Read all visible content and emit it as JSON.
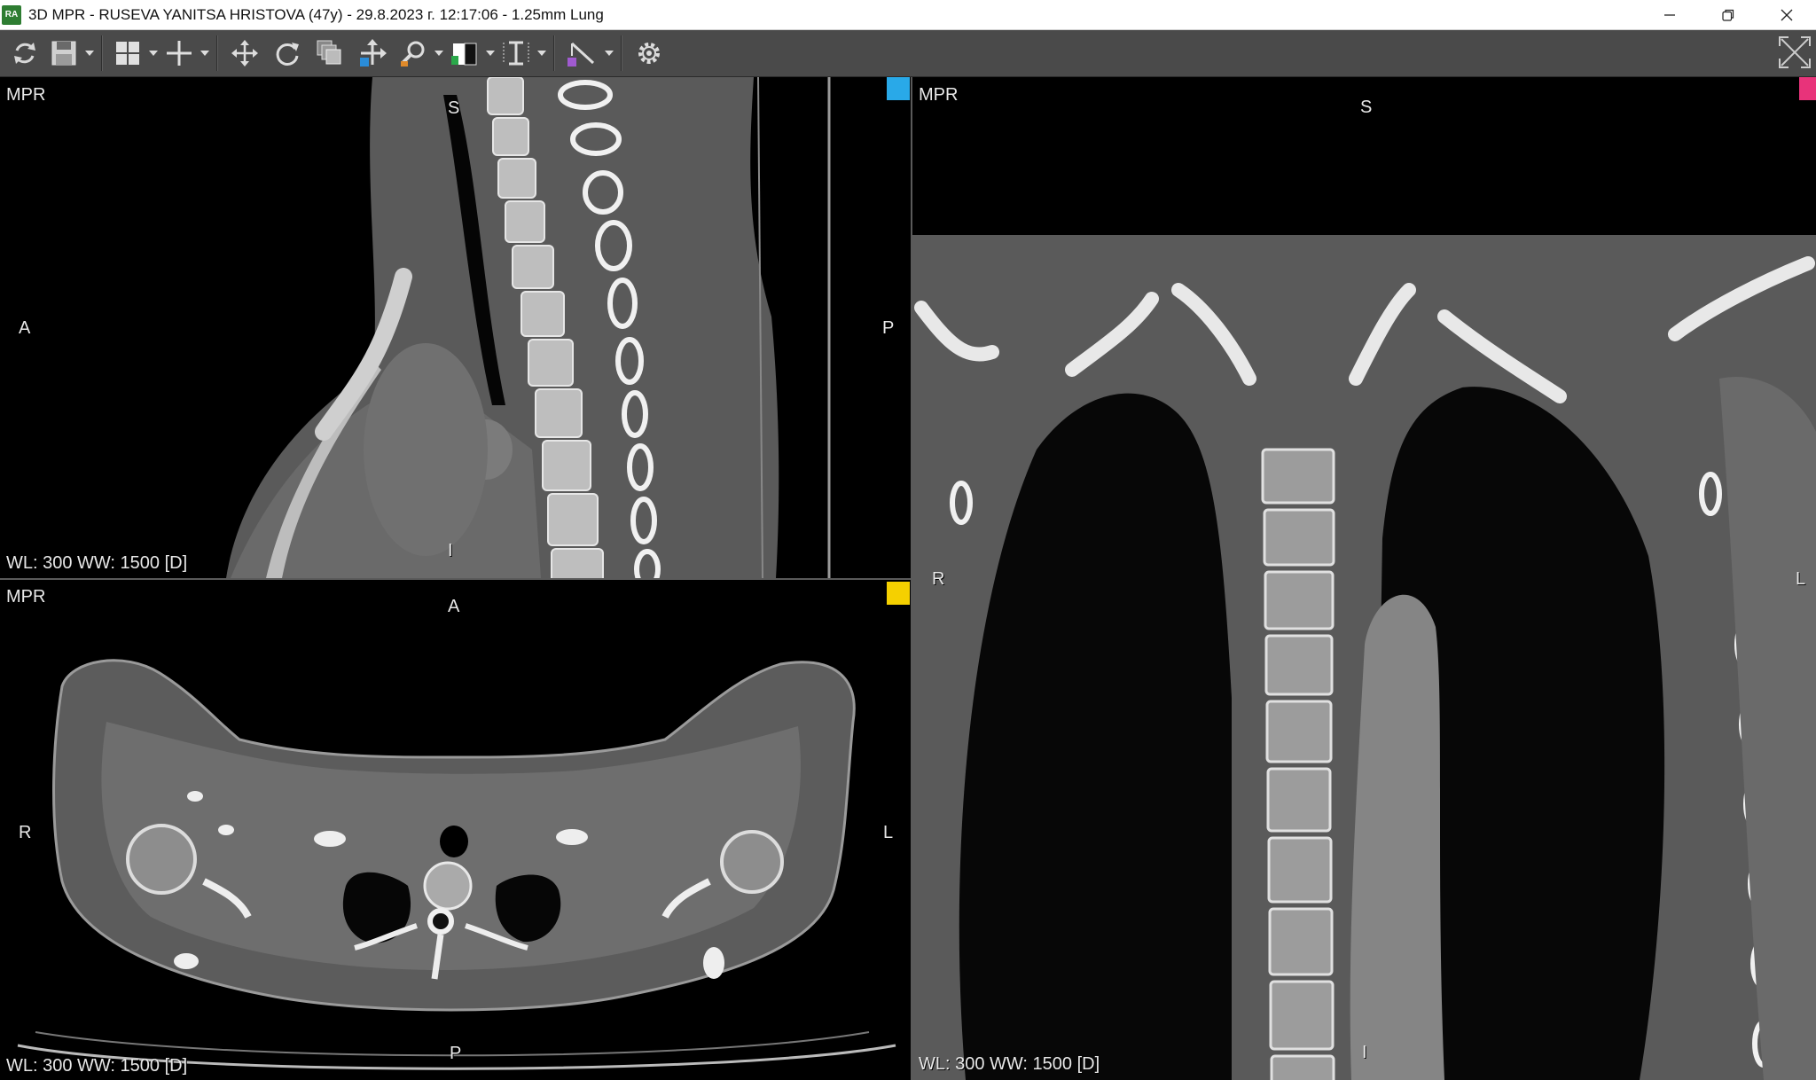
{
  "window": {
    "app_icon": "RA",
    "title": "3D MPR - RUSEVA YANITSA HRISTOVA (47y) - 29.8.2023 г. 12:17:06 - 1.25mm Lung",
    "controls": [
      "minimize-icon",
      "restore-icon",
      "close-icon"
    ]
  },
  "toolbar": {
    "tools": [
      "refresh-icon",
      "save-icon",
      "layout-grid-icon",
      "crosshair-icon",
      "pan-icon",
      "rotate-icon",
      "stack-icon",
      "move-icon",
      "zoom-icon",
      "window-level-icon",
      "slab-thickness-icon",
      "measure-icon",
      "settings-icon",
      "fullscreen-icon"
    ]
  },
  "viewports": {
    "sagittal": {
      "label": "MPR",
      "top": "S",
      "bottom": "I",
      "left": "A",
      "right": "P",
      "wl": "WL: 300 WW: 1500 [D]",
      "marker_color": "#29a9e8"
    },
    "axial": {
      "label": "MPR",
      "top": "A",
      "bottom": "P",
      "left": "R",
      "right": "L",
      "wl": "WL: 300 WW: 1500 [D]",
      "marker_color": "#f5d000"
    },
    "coronal": {
      "label": "MPR",
      "top": "S",
      "bottom": "I",
      "left": "R",
      "right": "L",
      "wl": "WL: 300 WW: 1500 [D]",
      "marker_color": "#e8337a"
    }
  }
}
